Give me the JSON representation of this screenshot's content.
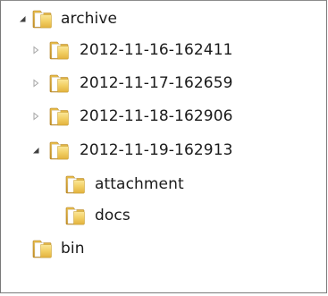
{
  "tree": {
    "items": [
      {
        "label": "archive",
        "expanded": true,
        "icon": "folder-icon"
      },
      {
        "label": "2012-11-16-162411",
        "expanded": false,
        "icon": "folder-icon"
      },
      {
        "label": "2012-11-17-162659",
        "expanded": false,
        "icon": "folder-icon"
      },
      {
        "label": "2012-11-18-162906",
        "expanded": false,
        "icon": "folder-icon"
      },
      {
        "label": "2012-11-19-162913",
        "expanded": true,
        "icon": "folder-icon"
      },
      {
        "label": "attachment",
        "icon": "folder-icon"
      },
      {
        "label": "docs",
        "icon": "folder-icon"
      },
      {
        "label": "bin",
        "icon": "folder-icon"
      }
    ]
  },
  "colors": {
    "expanded_arrow": "#404040",
    "collapsed_arrow": "#a6a6a6",
    "folder_front": "#f2cf63",
    "folder_back": "#d9a931",
    "text": "#1a1a1a"
  }
}
